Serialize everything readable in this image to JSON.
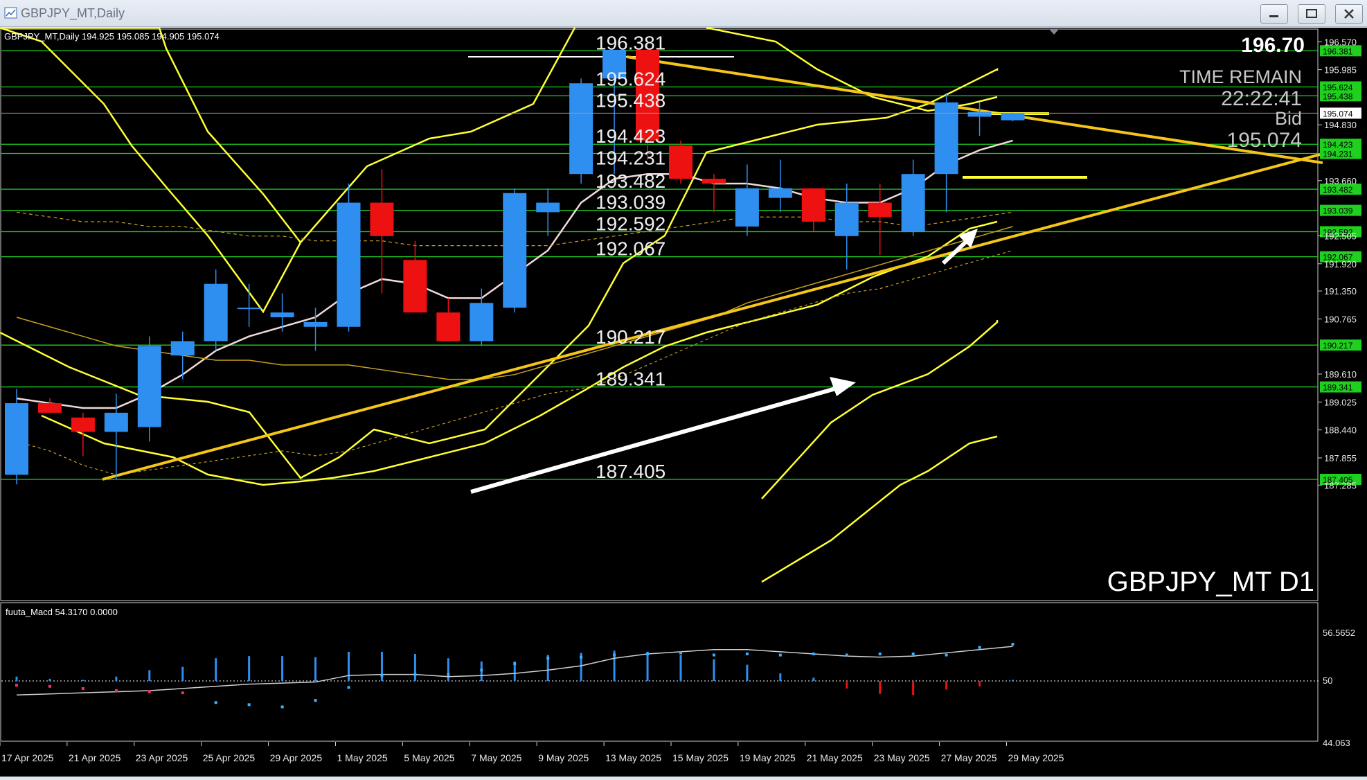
{
  "window": {
    "title": "GBPJPY_MT,Daily",
    "buttons": [
      "minimize",
      "maximize",
      "close"
    ]
  },
  "header": {
    "ohlc": "GBPJPY_MT,Daily  194.925 195.085 194.905 195.074"
  },
  "info": {
    "top_price": "196.70",
    "time_remain_label": "TIME REMAIN",
    "time_remain": "22:22:41",
    "bid_label": "Bid",
    "bid": "195.074",
    "symbol_label": "GBPJPY_MT D1"
  },
  "levels": [
    {
      "label": "196.381",
      "value": 196.381
    },
    {
      "label": "195.624",
      "value": 195.624
    },
    {
      "label": "195.438",
      "value": 195.438
    },
    {
      "label": "194.423",
      "value": 194.423
    },
    {
      "label": "194.231",
      "value": 194.231
    },
    {
      "label": "193.482",
      "value": 193.482
    },
    {
      "label": "193.039",
      "value": 193.039
    },
    {
      "label": "192.592",
      "value": 192.592
    },
    {
      "label": "192.067",
      "value": 192.067
    },
    {
      "label": "190.217",
      "value": 190.217
    },
    {
      "label": "189.341",
      "value": 189.341
    },
    {
      "label": "187.405",
      "value": 187.405
    }
  ],
  "price_scale": {
    "ticks": [
      "196.570",
      "195.985",
      "194.830",
      "193.660",
      "192.505",
      "191.920",
      "191.350",
      "190.765",
      "189.610",
      "189.025",
      "188.440",
      "187.855",
      "187.285"
    ],
    "tick_values": [
      196.57,
      195.985,
      194.83,
      193.66,
      192.505,
      191.92,
      191.35,
      190.765,
      189.61,
      189.025,
      188.44,
      187.855,
      187.285
    ],
    "current": "195.074"
  },
  "date_axis": [
    "17 Apr 2025",
    "21 Apr 2025",
    "23 Apr 2025",
    "25 Apr 2025",
    "29 Apr 2025",
    "1 May 2025",
    "5 May 2025",
    "7 May 2025",
    "9 May 2025",
    "13 May 2025",
    "15 May 2025",
    "19 May 2025",
    "21 May 2025",
    "23 May 2025",
    "27 May 2025",
    "29 May 2025"
  ],
  "macd": {
    "label": "fuuta_Macd 54.3170  0.0000",
    "scale": [
      "56.5652",
      "50",
      "44.063"
    ]
  },
  "colors": {
    "bull": "#2f8ff0",
    "bear": "#ee1111",
    "level_line": "#1fd01f",
    "envelope": "#ffff33",
    "trendline": "#f5c518",
    "ma_fast": "#f2d9d9",
    "ma_slow": "#c8a020",
    "arrow": "#ffffff"
  },
  "chart_data": {
    "type": "candlestick",
    "symbol": "GBPJPY_MT",
    "timeframe": "Daily",
    "dates": [
      "17 Apr",
      "18 Apr",
      "21 Apr",
      "22 Apr",
      "23 Apr",
      "24 Apr",
      "25 Apr",
      "28 Apr",
      "29 Apr",
      "30 Apr",
      "1 May",
      "2 May",
      "5 May",
      "6 May",
      "7 May",
      "8 May",
      "9 May",
      "12 May",
      "13 May",
      "14 May",
      "15 May",
      "16 May",
      "19 May",
      "20 May",
      "21 May",
      "22 May",
      "23 May",
      "26 May",
      "27 May",
      "28 May",
      "29 May"
    ],
    "ohlc": [
      [
        187.5,
        189.3,
        187.3,
        189.0
      ],
      [
        189.0,
        189.1,
        188.8,
        188.8
      ],
      [
        188.7,
        188.8,
        187.9,
        188.4
      ],
      [
        188.4,
        189.2,
        187.4,
        188.8
      ],
      [
        188.5,
        190.4,
        188.2,
        190.2
      ],
      [
        190.0,
        190.5,
        189.5,
        190.3
      ],
      [
        190.3,
        191.8,
        190.1,
        191.5
      ],
      [
        191.0,
        191.5,
        190.6,
        191.0
      ],
      [
        190.8,
        191.3,
        190.5,
        190.9
      ],
      [
        190.6,
        191.0,
        190.1,
        190.7
      ],
      [
        190.6,
        193.6,
        190.5,
        193.2
      ],
      [
        193.2,
        193.9,
        191.3,
        192.5
      ],
      [
        192.0,
        192.4,
        191.0,
        190.9
      ],
      [
        190.9,
        191.2,
        190.3,
        190.3
      ],
      [
        190.3,
        191.4,
        190.2,
        191.1
      ],
      [
        191.0,
        193.5,
        190.9,
        193.4
      ],
      [
        193.0,
        193.5,
        192.5,
        193.2
      ],
      [
        193.8,
        195.8,
        193.6,
        195.7
      ],
      [
        195.8,
        196.4,
        193.8,
        196.4
      ],
      [
        196.4,
        196.6,
        194.1,
        194.5
      ],
      [
        194.4,
        194.5,
        193.6,
        193.7
      ],
      [
        193.7,
        193.8,
        193.0,
        193.6
      ],
      [
        192.7,
        194.0,
        192.5,
        193.5
      ],
      [
        193.3,
        194.1,
        193.0,
        193.5
      ],
      [
        193.5,
        193.5,
        192.6,
        192.8
      ],
      [
        192.5,
        193.6,
        191.8,
        193.2
      ],
      [
        193.2,
        193.6,
        192.1,
        192.9
      ],
      [
        192.6,
        194.1,
        192.5,
        193.8
      ],
      [
        193.8,
        195.5,
        193.0,
        195.3
      ],
      [
        195.0,
        195.3,
        194.6,
        195.1
      ],
      [
        194.925,
        195.085,
        194.905,
        195.074
      ]
    ],
    "y_range": [
      187.285,
      196.7
    ],
    "horizontal_levels": [
      196.381,
      195.624,
      195.438,
      194.423,
      194.231,
      193.482,
      193.039,
      192.592,
      192.067,
      190.217,
      189.341,
      187.405
    ],
    "macd_range": [
      44.063,
      56.5652
    ]
  }
}
